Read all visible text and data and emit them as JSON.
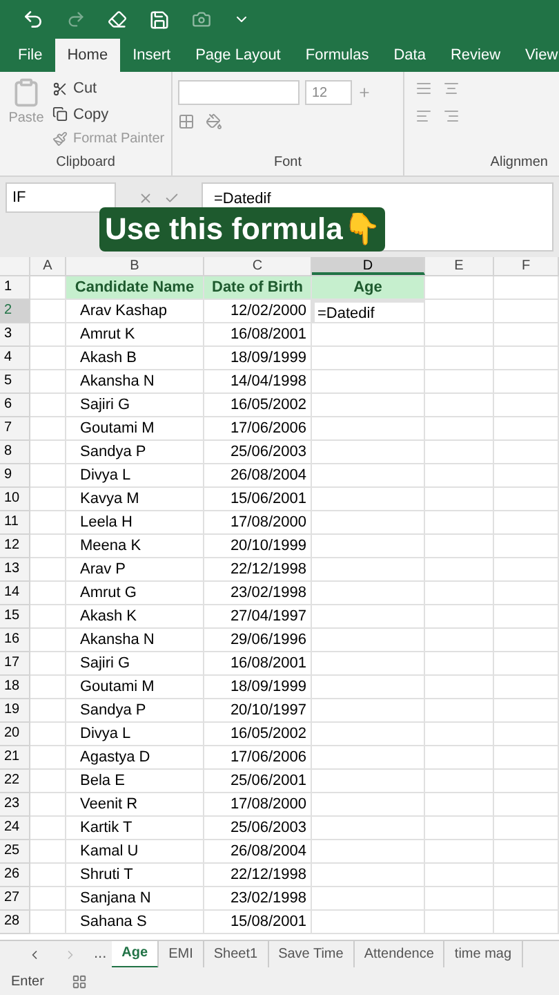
{
  "ribbon_tabs": [
    {
      "label": "File",
      "selected": false
    },
    {
      "label": "Home",
      "selected": true
    },
    {
      "label": "Insert",
      "selected": false
    },
    {
      "label": "Page Layout",
      "selected": false
    },
    {
      "label": "Formulas",
      "selected": false
    },
    {
      "label": "Data",
      "selected": false
    },
    {
      "label": "Review",
      "selected": false
    },
    {
      "label": "View",
      "selected": false
    }
  ],
  "clipboard": {
    "paste": "Paste",
    "cut": "Cut",
    "copy": "Copy",
    "format_painter": "Format Painter",
    "label": "Clipboard"
  },
  "font": {
    "size": "12",
    "label": "Font"
  },
  "alignment": {
    "label": "Alignmen"
  },
  "name_box": "IF",
  "formula": "=Datedif",
  "caption": "Use this formula👇",
  "columns": [
    {
      "label": "A",
      "selected": false
    },
    {
      "label": "B",
      "selected": false
    },
    {
      "label": "C",
      "selected": false
    },
    {
      "label": "D",
      "selected": true
    },
    {
      "label": "E",
      "selected": false
    },
    {
      "label": "F",
      "selected": false
    }
  ],
  "rows": [
    {
      "number": "1",
      "kind": "header",
      "name": "Candidate Name",
      "dob": "Date of Birth",
      "age": "Age",
      "selected": false
    },
    {
      "number": "2",
      "kind": "data",
      "name": "Arav Kashap",
      "dob": "12/02/2000",
      "age": "=Datedif",
      "selected": true
    },
    {
      "number": "3",
      "kind": "data",
      "name": "Amrut K",
      "dob": "16/08/2001",
      "selected": false
    },
    {
      "number": "4",
      "kind": "data",
      "name": "Akash B",
      "dob": "18/09/1999",
      "selected": false
    },
    {
      "number": "5",
      "kind": "data",
      "name": "Akansha N",
      "dob": "14/04/1998",
      "selected": false
    },
    {
      "number": "6",
      "kind": "data",
      "name": "Sajiri G",
      "dob": "16/05/2002",
      "selected": false
    },
    {
      "number": "7",
      "kind": "data",
      "name": "Goutami M",
      "dob": "17/06/2006",
      "selected": false
    },
    {
      "number": "8",
      "kind": "data",
      "name": "Sandya P",
      "dob": "25/06/2003",
      "selected": false
    },
    {
      "number": "9",
      "kind": "data",
      "name": "Divya L",
      "dob": "26/08/2004",
      "selected": false
    },
    {
      "number": "10",
      "kind": "data",
      "name": "Kavya M",
      "dob": "15/06/2001",
      "selected": false
    },
    {
      "number": "11",
      "kind": "data",
      "name": "Leela H",
      "dob": "17/08/2000",
      "selected": false
    },
    {
      "number": "12",
      "kind": "data",
      "name": "Meena K",
      "dob": "20/10/1999",
      "selected": false
    },
    {
      "number": "13",
      "kind": "data",
      "name": "Arav P",
      "dob": "22/12/1998",
      "selected": false
    },
    {
      "number": "14",
      "kind": "data",
      "name": "Amrut G",
      "dob": "23/02/1998",
      "selected": false
    },
    {
      "number": "15",
      "kind": "data",
      "name": "Akash K",
      "dob": "27/04/1997",
      "selected": false
    },
    {
      "number": "16",
      "kind": "data",
      "name": "Akansha N",
      "dob": "29/06/1996",
      "selected": false
    },
    {
      "number": "17",
      "kind": "data",
      "name": "Sajiri G",
      "dob": "16/08/2001",
      "selected": false
    },
    {
      "number": "18",
      "kind": "data",
      "name": "Goutami M",
      "dob": "18/09/1999",
      "selected": false
    },
    {
      "number": "19",
      "kind": "data",
      "name": "Sandya P",
      "dob": "20/10/1997",
      "selected": false
    },
    {
      "number": "20",
      "kind": "data",
      "name": "Divya L",
      "dob": "16/05/2002",
      "selected": false
    },
    {
      "number": "21",
      "kind": "data",
      "name": "Agastya D",
      "dob": "17/06/2006",
      "selected": false
    },
    {
      "number": "22",
      "kind": "data",
      "name": "Bela E",
      "dob": "25/06/2001",
      "selected": false
    },
    {
      "number": "23",
      "kind": "data",
      "name": "Veenit R",
      "dob": "17/08/2000",
      "selected": false
    },
    {
      "number": "24",
      "kind": "data",
      "name": "Kartik T",
      "dob": "25/06/2003",
      "selected": false
    },
    {
      "number": "25",
      "kind": "data",
      "name": "Kamal U",
      "dob": "26/08/2004",
      "selected": false
    },
    {
      "number": "26",
      "kind": "data",
      "name": "Shruti T",
      "dob": "22/12/1998",
      "selected": false
    },
    {
      "number": "27",
      "kind": "data",
      "name": "Sanjana N",
      "dob": "23/02/1998",
      "selected": false
    },
    {
      "number": "28",
      "kind": "data",
      "name": "Sahana S",
      "dob": "15/08/2001",
      "selected": false
    }
  ],
  "sheet_nav": {
    "more": "..."
  },
  "sheets": [
    {
      "label": "Age",
      "selected": true
    },
    {
      "label": "EMI",
      "selected": false
    },
    {
      "label": "Sheet1",
      "selected": false
    },
    {
      "label": "Save Time",
      "selected": false
    },
    {
      "label": "Attendence",
      "selected": false
    },
    {
      "label": "time mag",
      "selected": false
    }
  ],
  "status": "Enter"
}
